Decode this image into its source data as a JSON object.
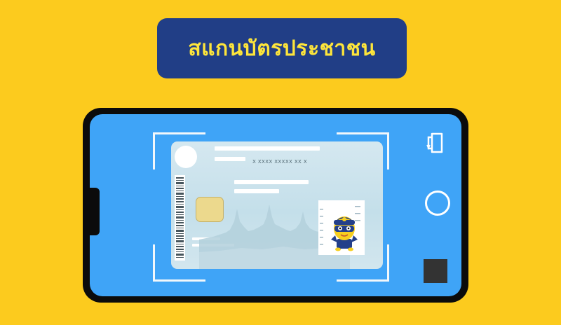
{
  "title": {
    "text": "สแกนบัตรประชาชน"
  },
  "id_card": {
    "number_text": "X XXXX XXXXX XX X"
  },
  "icons": {
    "switch_camera": "switch-camera-icon",
    "shutter": "shutter-icon",
    "gallery": "gallery-icon",
    "mascot": "mascot-icon",
    "barcode": "barcode-icon",
    "chip": "chip-icon",
    "temple": "temple-silhouette-icon",
    "seal": "seal-icon"
  },
  "colors": {
    "background": "#fccb1e",
    "title_pill": "#213e86",
    "title_text": "#fde53b",
    "phone_frame": "#0b0b0b",
    "screen": "#3fa4f7",
    "card": "#d5e8f0"
  }
}
